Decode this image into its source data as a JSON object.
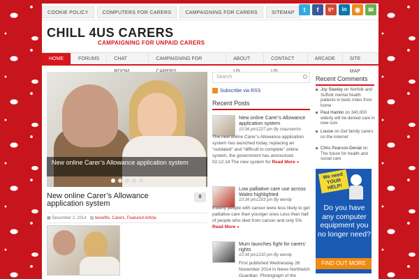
{
  "colors": {
    "accent": "#d8141d",
    "background_red": "#c8141c",
    "link_blue": "#224488",
    "ad_blue": "#1a5ab4",
    "ad_orange": "#f08a10"
  },
  "topmenu": {
    "items": [
      "COOKIE POLICY",
      "COMPUTERS FOR CARERS",
      "CAMPAIGNING FOR CARERS",
      "SITEMAP"
    ]
  },
  "social": [
    {
      "icon": "twitter-icon",
      "glyph": "t",
      "color": "#33aadd"
    },
    {
      "icon": "facebook-icon",
      "glyph": "f",
      "color": "#3b5998"
    },
    {
      "icon": "google-plus-icon",
      "glyph": "g+",
      "color": "#d34836"
    },
    {
      "icon": "linkedin-icon",
      "glyph": "in",
      "color": "#0e76a8"
    },
    {
      "icon": "rss-icon",
      "glyph": "◉",
      "color": "#f08a24"
    },
    {
      "icon": "email-icon",
      "glyph": "✉",
      "color": "#6ab04c"
    }
  ],
  "header": {
    "logo": "CHILL 4US CARERS",
    "tagline": "CAMPAIGNING FOR UNPAID CARERS"
  },
  "mainnav": {
    "items": [
      "HOME",
      "FORUMS",
      "CHAT ROOM",
      "CAMPAIGNING FOR CARERS",
      "ABOUT US",
      "CONTACT US",
      "ARCADE",
      "SITE MAP"
    ],
    "active": "HOME"
  },
  "slider": {
    "caption": "New online Carer’s Allowance application system",
    "dots": 5,
    "active_dot": 1
  },
  "post": {
    "title": "New online Carer’s Allowance application system",
    "comments": "0",
    "date": "December 2, 2014",
    "categories": "benefits, Carers, Featured Article"
  },
  "sidebar_mid": {
    "search_placeholder": "Search",
    "rss_label": "Subscribe via RSS",
    "recent_title": "Recent Posts",
    "posts": [
      {
        "title": "New online Carer’s Allowance application system",
        "meta": "10:34 pm1227 pm By maureenho",
        "excerpt": "The new online Carer’s Allowance application system has launched today, replacing an “outdated” and “difficult to complete” online system, the government has announced.  02.12.14 The new system for",
        "more": "Read More »"
      },
      {
        "title": "Low palliative care use across Wales highlighted",
        "meta": "10:34 pm1203 pm By wendy",
        "excerpt": "Elderly people with cancer were less likely to get palliative care than younger ones Less than half of people who died from cancer and only 5%",
        "more": "Read More »"
      },
      {
        "title": "Mum launches fight for carers’ rights",
        "meta": "10:34 pm1210 pm By wendy",
        "excerpt": "First published Wednesday 26 November 2014 in News Northwich Guardian: Photograph of the Author by Gina"
      }
    ]
  },
  "sidebar_right": {
    "title": "Recent Comments",
    "comments": [
      {
        "name": "Joy Stanley",
        "text": " on Norfolk and Suffolk mental health patients in beds miles from home"
      },
      {
        "name": "Paul Hamlin",
        "text": " on 340,000 elderly will be denied care in new cuts"
      },
      {
        "name": "Louise",
        "text": " on Get family carers on the internet"
      },
      {
        "name": "Chris Pearson-Denial",
        "text": " on The future for health and social care"
      }
    ],
    "ad": {
      "sign": "We need YOUR HELP!",
      "text": "Do you have any computer equipment you no longer need?",
      "button": "FIND OUT MORE"
    }
  }
}
